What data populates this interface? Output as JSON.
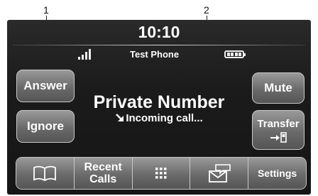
{
  "callouts": [
    "1",
    "2"
  ],
  "status_bar": {
    "time": "10:10",
    "phone_name": "Test Phone",
    "signal_icon": "signal-bars-icon",
    "battery_icon": "battery-icon"
  },
  "call": {
    "caller": "Private Number",
    "status": "Incoming call...",
    "status_icon": "incoming-arrow-icon"
  },
  "left_buttons": {
    "answer": "Answer",
    "ignore": "Ignore"
  },
  "right_buttons": {
    "mute": "Mute",
    "transfer": "Transfer",
    "transfer_icon": "transfer-to-phone-icon"
  },
  "bottom_bar": {
    "phonebook_icon": "phonebook-icon",
    "recent_calls": "Recent Calls",
    "keypad_icon": "keypad-icon",
    "messages_icon": "messages-icon",
    "settings": "Settings"
  },
  "colors": {
    "screen_bg": "#1b1b1b",
    "button": "#6a6a6a",
    "button_border": "#c8c8c8",
    "text": "#ffffff"
  }
}
